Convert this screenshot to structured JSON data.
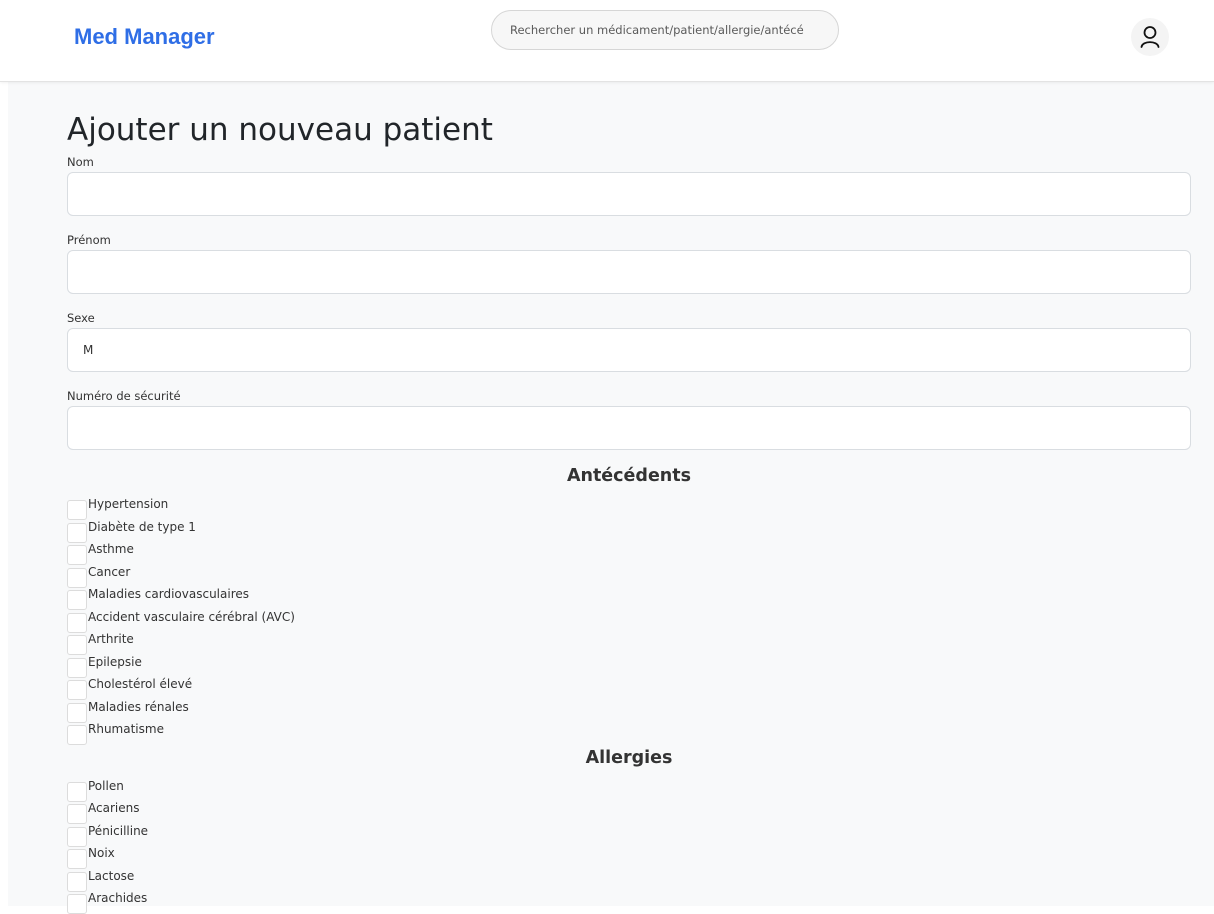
{
  "header": {
    "brand": "Med Manager",
    "search_placeholder": "Rechercher un médicament/patient/allergie/antécé",
    "user_icon": "user-icon"
  },
  "page": {
    "title": "Ajouter un nouveau patient"
  },
  "form": {
    "nom": {
      "label": "Nom",
      "value": ""
    },
    "prenom": {
      "label": "Prénom",
      "value": ""
    },
    "sexe": {
      "label": "Sexe",
      "value": "M"
    },
    "secu": {
      "label": "Numéro de sécurité",
      "value": ""
    }
  },
  "antecedents": {
    "title": "Antécédents",
    "items": [
      "Hypertension",
      "Diabète de type 1",
      "Asthme",
      "Cancer",
      "Maladies cardiovasculaires",
      "Accident vasculaire cérébral (AVC)",
      "Arthrite",
      "Epilepsie",
      "Cholestérol élevé",
      "Maladies rénales",
      "Rhumatisme"
    ]
  },
  "allergies": {
    "title": "Allergies",
    "items": [
      "Pollen",
      "Acariens",
      "Pénicilline",
      "Noix",
      "Lactose",
      "Arachides"
    ]
  },
  "colors": {
    "brand": "#2f6ee6",
    "background": "#f8f9fa"
  }
}
